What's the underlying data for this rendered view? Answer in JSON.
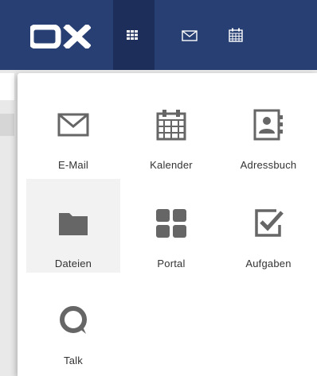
{
  "brand": {
    "logo_text": "OX",
    "topbar_color": "#283f73",
    "launcher_active_color": "#1c2e59",
    "icon_color": "#666666"
  },
  "topbar": {
    "launcher_icon": "grid-icon",
    "shortcuts": [
      {
        "icon": "mail-icon"
      },
      {
        "icon": "calendar-icon"
      }
    ]
  },
  "launcher": {
    "apps": [
      {
        "label": "E-Mail",
        "icon": "mail-icon",
        "active": false
      },
      {
        "label": "Kalender",
        "icon": "calendar-icon",
        "active": false
      },
      {
        "label": "Adressbuch",
        "icon": "address-book-icon",
        "active": false
      },
      {
        "label": "Dateien",
        "icon": "folder-icon",
        "active": true
      },
      {
        "label": "Portal",
        "icon": "portal-tiles-icon",
        "active": false
      },
      {
        "label": "Aufgaben",
        "icon": "tasks-check-icon",
        "active": false
      },
      {
        "label": "Talk",
        "icon": "talk-icon",
        "active": false
      }
    ]
  }
}
